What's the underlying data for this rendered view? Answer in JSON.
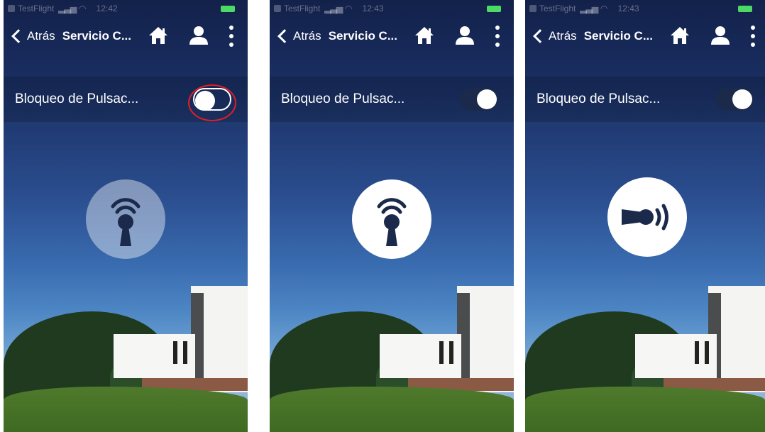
{
  "status_bar": {
    "app": "TestFlight",
    "times": [
      "12:42",
      "12:43",
      "12:43"
    ]
  },
  "nav": {
    "back_label": "Atrás",
    "title": "Servicio C...",
    "icons": [
      "home-icon",
      "user-icon",
      "more-vertical-icon"
    ]
  },
  "setting": {
    "label": "Bloqueo de Pulsac..."
  },
  "screens": [
    {
      "toggle_state": "off",
      "highlighted": true,
      "action_icon": "keyhole-broadcast-icon",
      "action_enabled": false
    },
    {
      "toggle_state": "on",
      "highlighted": false,
      "action_icon": "keyhole-broadcast-icon",
      "action_enabled": true
    },
    {
      "toggle_state": "on",
      "highlighted": false,
      "action_icon": "horn-sound-icon",
      "action_enabled": true
    }
  ],
  "colors": {
    "sky_top": "#13214a",
    "sky_bottom": "#8fb5d9",
    "battery": "#4cd964",
    "highlight": "#e01e26",
    "icon_dark": "#1b2a4a"
  }
}
